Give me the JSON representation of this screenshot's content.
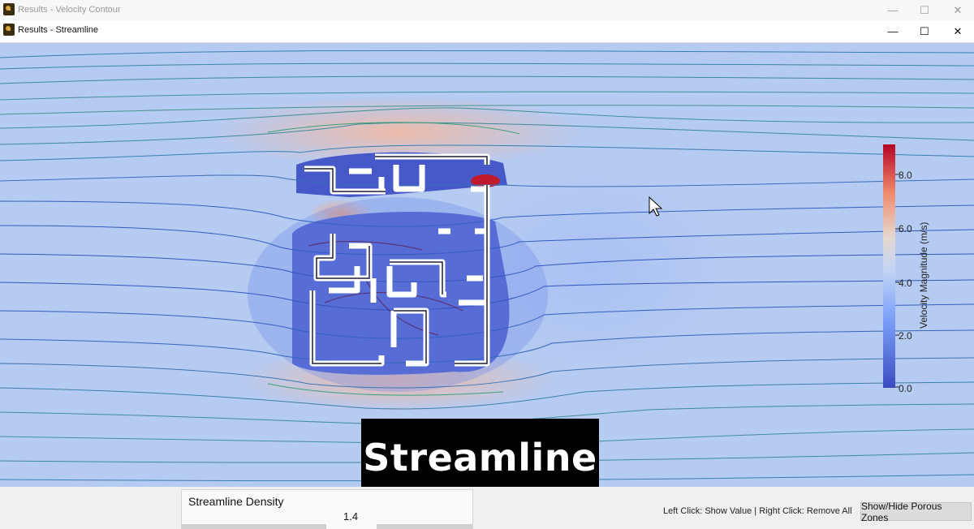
{
  "windows": {
    "back_title": "Results - Velocity Contour",
    "front_title": "Results - Streamline",
    "minimize_glyph": "—",
    "maximize_glyph": "☐",
    "close_glyph": "✕"
  },
  "colorbar": {
    "label": "Velocity Magnitude (m/s)",
    "ticks": [
      "8.0",
      "6.0",
      "4.0",
      "2.0",
      "0.0"
    ],
    "range": [
      0,
      9
    ],
    "colors": [
      "#3b4cc0",
      "#aec9f9",
      "#dcdcdc",
      "#f4a889",
      "#b40426"
    ]
  },
  "overlay_caption": "Streamline",
  "bottom_bar": {
    "density_label": "Streamline Density",
    "density_value": "1.4",
    "hint": "Left Click: Show Value | Right Click: Remove All",
    "porous_button": "Show/Hide Porous Zones"
  },
  "icons": [
    "app-icon",
    "minimize-icon",
    "maximize-icon",
    "close-icon",
    "mouse-cursor-icon"
  ]
}
